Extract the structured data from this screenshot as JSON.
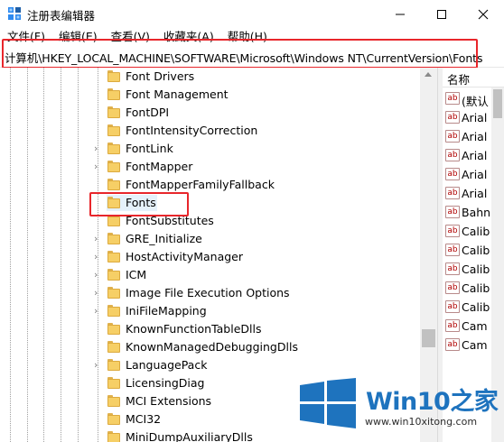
{
  "window": {
    "title": "注册表编辑器"
  },
  "menu": [
    {
      "label": "文件(F)"
    },
    {
      "label": "编辑(E)"
    },
    {
      "label": "查看(V)"
    },
    {
      "label": "收藏夹(A)"
    },
    {
      "label": "帮助(H)"
    }
  ],
  "address": {
    "path": "计算机\\HKEY_LOCAL_MACHINE\\SOFTWARE\\Microsoft\\Windows NT\\CurrentVersion\\Fonts"
  },
  "tree": {
    "selected": "Fonts",
    "items": [
      {
        "label": "Font Drivers",
        "expandable": false
      },
      {
        "label": "Font Management",
        "expandable": false
      },
      {
        "label": "FontDPI",
        "expandable": false
      },
      {
        "label": "FontIntensityCorrection",
        "expandable": false
      },
      {
        "label": "FontLink",
        "expandable": true
      },
      {
        "label": "FontMapper",
        "expandable": true
      },
      {
        "label": "FontMapperFamilyFallback",
        "expandable": false
      },
      {
        "label": "Fonts",
        "expandable": false
      },
      {
        "label": "FontSubstitutes",
        "expandable": false
      },
      {
        "label": "GRE_Initialize",
        "expandable": true
      },
      {
        "label": "HostActivityManager",
        "expandable": true
      },
      {
        "label": "ICM",
        "expandable": true
      },
      {
        "label": "Image File Execution Options",
        "expandable": true
      },
      {
        "label": "IniFileMapping",
        "expandable": true
      },
      {
        "label": "KnownFunctionTableDlls",
        "expandable": false
      },
      {
        "label": "KnownManagedDebuggingDlls",
        "expandable": false
      },
      {
        "label": "LanguagePack",
        "expandable": true
      },
      {
        "label": "LicensingDiag",
        "expandable": false
      },
      {
        "label": "MCI Extensions",
        "expandable": false
      },
      {
        "label": "MCI32",
        "expandable": false
      },
      {
        "label": "MiniDumpAuxiliaryDlls",
        "expandable": false
      }
    ]
  },
  "values": {
    "column_name": "名称",
    "items": [
      {
        "icon": "ab",
        "label": "(默认"
      },
      {
        "icon": "ab",
        "label": "Arial"
      },
      {
        "icon": "ab",
        "label": "Arial"
      },
      {
        "icon": "ab",
        "label": "Arial"
      },
      {
        "icon": "ab",
        "label": "Arial"
      },
      {
        "icon": "ab",
        "label": "Arial"
      },
      {
        "icon": "ab",
        "label": "Bahn"
      },
      {
        "icon": "ab",
        "label": "Calib"
      },
      {
        "icon": "ab",
        "label": "Calib"
      },
      {
        "icon": "ab",
        "label": "Calib"
      },
      {
        "icon": "ab",
        "label": "Calib"
      },
      {
        "icon": "ab",
        "label": "Calib"
      },
      {
        "icon": "ab",
        "label": "Cam"
      },
      {
        "icon": "ab",
        "label": "Cam"
      }
    ]
  },
  "watermark": {
    "brand": "Win10",
    "brand_suffix": "之家",
    "url": "www.win10xitong.com",
    "color": "#1e73be"
  },
  "colors": {
    "highlight_border": "#e8262b",
    "selection": "#e5f1fb",
    "folder": "#f6cf66"
  }
}
